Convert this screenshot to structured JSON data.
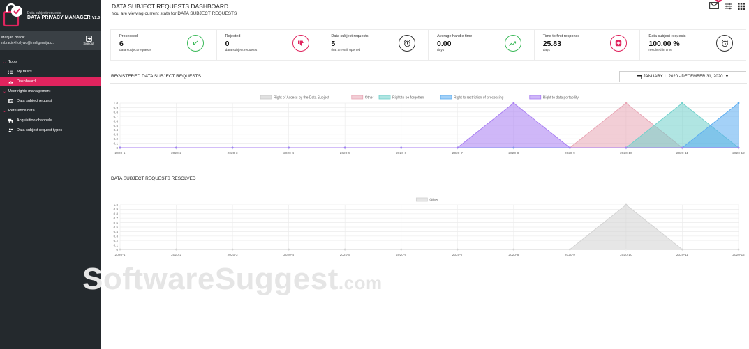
{
  "sidebar": {
    "brand_sub": "Data subject requests",
    "brand_title": "DATA PRIVACY MANAGER",
    "brand_version": "V2.0",
    "user_name": "Marijan Bracic",
    "user_email": "mbracic+hollywd@inteligencija.c...",
    "signout_label": "Signout",
    "groups": [
      {
        "label": "Tools",
        "items": [
          {
            "label": "My tasks",
            "icon": "list-icon",
            "active": false
          },
          {
            "label": "Dashboard",
            "icon": "gauge-icon",
            "active": true
          }
        ]
      },
      {
        "label": "User rights management",
        "items": [
          {
            "label": "Data subject request",
            "icon": "id-card-icon",
            "active": false
          }
        ]
      },
      {
        "label": "Reference data",
        "items": [
          {
            "label": "Acquisition channels",
            "icon": "truck-icon",
            "active": false
          },
          {
            "label": "Data subject request types",
            "icon": "users-icon",
            "active": false
          }
        ]
      }
    ]
  },
  "header": {
    "title": "DATA SUBJECT REQUESTS DASHBOARD",
    "subtitle": "You are viewing current stats for DATA SUBJECT REQUESTS",
    "mail_badge": "1"
  },
  "stats": [
    {
      "label": "Processed",
      "value": "6",
      "note": "data subject requests",
      "icon": "arrow-down-left-icon",
      "color": "green"
    },
    {
      "label": "Rejected",
      "value": "0",
      "note": "data subject requests",
      "icon": "thumbs-down-icon",
      "color": "red"
    },
    {
      "label": "Data subject requests",
      "value": "5",
      "note": "that are still opened",
      "icon": "alarm-clock-icon",
      "color": "dark"
    },
    {
      "label": "Average handle time",
      "value": "0.00",
      "note": "days",
      "icon": "trend-up-icon",
      "color": "green"
    },
    {
      "label": "Time to first response",
      "value": "25.83",
      "note": "days",
      "icon": "medical-plus-icon",
      "color": "red"
    },
    {
      "label": "Data subject requests",
      "value": "100.00 %",
      "note": "resolved in time",
      "icon": "alarm-clock-icon",
      "color": "dark"
    }
  ],
  "section1": {
    "title": "REGISTERED DATA SUBJECT REQUESTS"
  },
  "date_range": "JANUARY 1, 2020 - DECEMBER 31, 2020",
  "section2": {
    "title": "DATA SUBJECT REQUESTS RESOLVED"
  },
  "watermark": {
    "main": "SoftwareSuggest",
    "suffix": ".com"
  },
  "chart_data": [
    {
      "type": "area",
      "categories": [
        "2020-1",
        "2020-2",
        "2020-3",
        "2020-4",
        "2020-5",
        "2020-6",
        "2020-7",
        "2020-8",
        "2020-9",
        "2020-10",
        "2020-11",
        "2020-12"
      ],
      "ylim": [
        0,
        1.0
      ],
      "yticks": [
        "0",
        "0.1",
        "0.2",
        "0.3",
        "0.4",
        "0.5",
        "0.6",
        "0.7",
        "0.8",
        "0.9",
        "1.0"
      ],
      "grid": true,
      "legend": "top",
      "series": [
        {
          "name": "Right of Access by the Data Subject",
          "color": "#c9c9c9",
          "values": [
            0,
            0,
            0,
            0,
            0,
            0,
            0,
            0,
            0,
            0,
            0,
            0
          ]
        },
        {
          "name": "Other",
          "color": "#e8a5b4",
          "values": [
            0,
            0,
            0,
            0,
            0,
            0,
            0,
            0,
            0,
            1,
            0,
            0
          ]
        },
        {
          "name": "Right to be forgotten",
          "color": "#6fd0cb",
          "values": [
            0,
            0,
            0,
            0,
            0,
            0,
            0,
            0,
            0,
            0,
            1,
            0
          ]
        },
        {
          "name": "Right to restriction of processing",
          "color": "#5aacf0",
          "values": [
            0,
            0,
            0,
            0,
            0,
            0,
            0,
            0,
            0,
            0,
            0,
            1
          ]
        },
        {
          "name": "Right to data portability",
          "color": "#a77cf2",
          "values": [
            0,
            0,
            0,
            0,
            0,
            0,
            0,
            1,
            0,
            0,
            0,
            0
          ]
        }
      ]
    },
    {
      "type": "area",
      "categories": [
        "2020-1",
        "2020-2",
        "2020-3",
        "2020-4",
        "2020-5",
        "2020-6",
        "2020-7",
        "2020-8",
        "2020-9",
        "2020-10",
        "2020-11",
        "2020-12"
      ],
      "ylim": [
        0,
        1.0
      ],
      "yticks": [
        "0",
        "0.1",
        "0.2",
        "0.3",
        "0.4",
        "0.5",
        "0.6",
        "0.7",
        "0.8",
        "0.9",
        "1.0"
      ],
      "grid": true,
      "legend": "top",
      "series": [
        {
          "name": "Other",
          "color": "#d2d2d2",
          "values": [
            0,
            0,
            0,
            0,
            0,
            0,
            0,
            0,
            0,
            1,
            0,
            0
          ]
        }
      ]
    }
  ]
}
